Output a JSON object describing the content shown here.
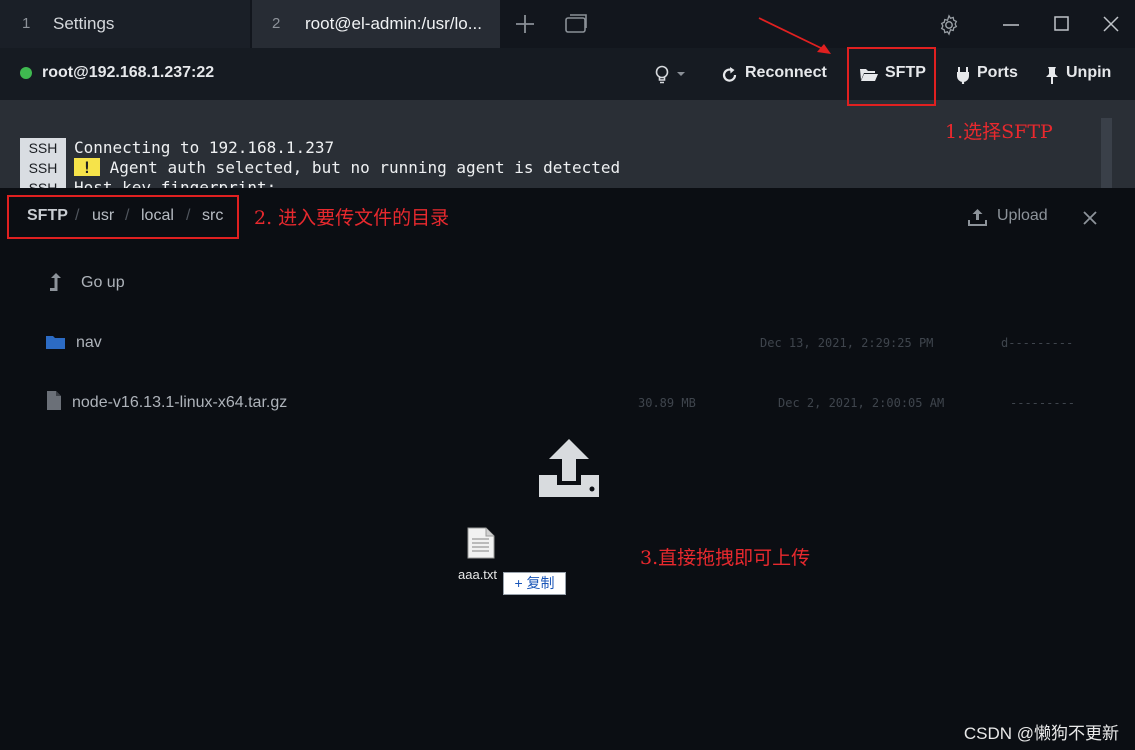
{
  "tabs": [
    {
      "number": "1",
      "label": "Settings"
    },
    {
      "number": "2",
      "label": "root@el-admin:/usr/lo..."
    }
  ],
  "toolbar": {
    "connection": "root@192.168.1.237:22",
    "status_color": "#3fb950",
    "reconnect": "Reconnect",
    "sftp": "SFTP",
    "ports": "Ports",
    "unpin": "Unpin"
  },
  "terminal": {
    "tag": "SSH",
    "lines": [
      "Connecting to 192.168.1.237",
      "Agent auth selected, but no running agent is detected",
      "Host key fingerprint:"
    ],
    "warning_symbol": "!"
  },
  "sftp_panel": {
    "breadcrumb": [
      "SFTP",
      "usr",
      "local",
      "src"
    ],
    "upload": "Upload",
    "go_up": "Go up",
    "files": [
      {
        "name": "nav",
        "type": "folder",
        "size": "",
        "modified": "Dec 13, 2021, 2:29:25 PM",
        "mode": "d---------"
      },
      {
        "name": "node-v16.13.1-linux-x64.tar.gz",
        "type": "file",
        "size": "30.89 MB",
        "modified": "Dec 2, 2021, 2:00:05 AM",
        "mode": "---------"
      }
    ],
    "dragged_file": "aaa.txt",
    "copy_badge": "+ 复制"
  },
  "annotations": {
    "step1": "1.选择SFTP",
    "step2": "2. 进入要传文件的目录",
    "step3": "3.直接拖拽即可上传",
    "color": "#e8292e"
  },
  "watermark": "CSDN @懒狗不更新"
}
